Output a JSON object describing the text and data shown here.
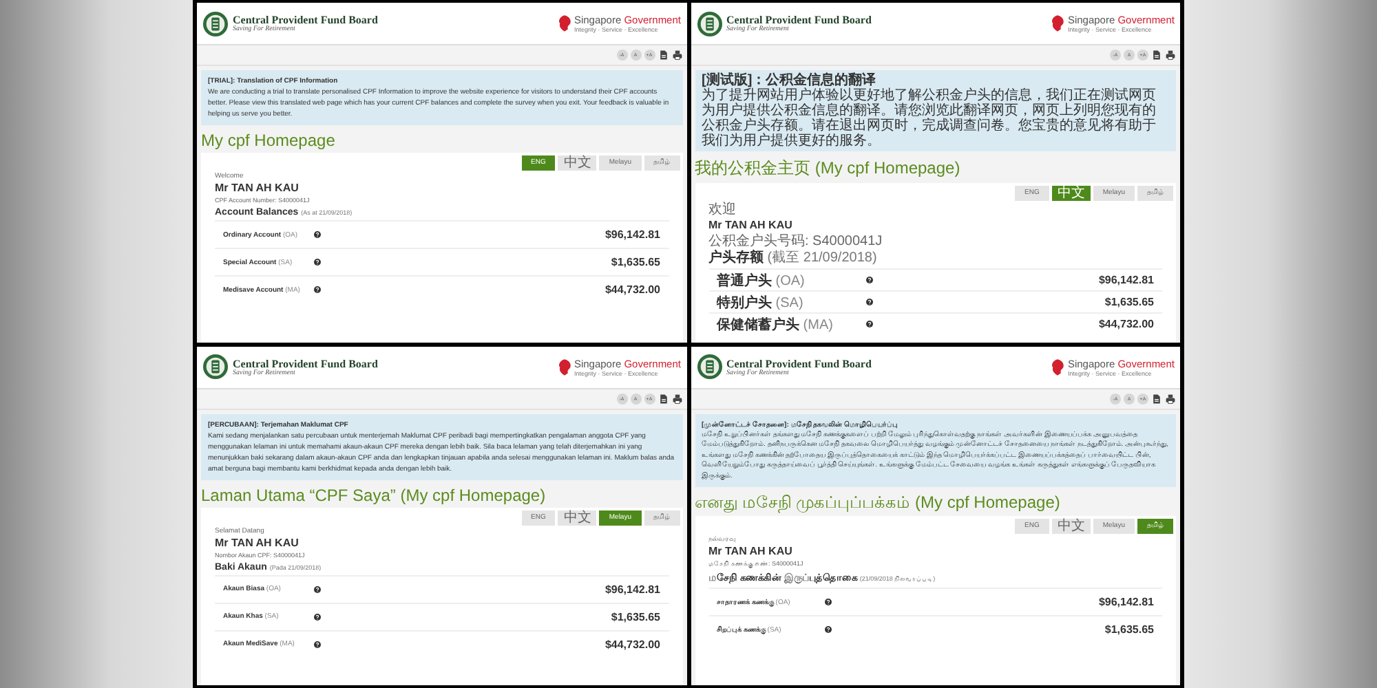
{
  "panels": [
    {
      "header": {
        "org": "Central Provident Fund Board",
        "motto": "Saving For Retirement",
        "gov_name": "Singapore",
        "gov_word": "Government",
        "gov_tagline": "Integrity · Service · Excellence"
      },
      "tools": [
        "-A",
        "A",
        "+A"
      ],
      "notice": {
        "title": "[TRIAL]: Translation of CPF Information",
        "body": "We are conducting a trial to translate personalised CPF Information to improve the website experience for visitors to understand their CPF accounts better. Please view this translated web page which has your current CPF balances and complete the survey when you exit. Your feedback is valuable in helping us serve you better."
      },
      "page_title": "My cpf Homepage",
      "languages": [
        {
          "label": "ENG",
          "selected": true
        },
        {
          "label": "中文",
          "selected": false
        },
        {
          "label": "Melayu",
          "selected": false
        },
        {
          "label": "தமிழ்",
          "selected": false
        }
      ],
      "welcome": "Welcome",
      "name": "Mr TAN AH KAU",
      "account_number": "CPF Account Number: S4000041J",
      "balances": {
        "heading": "Account Balances",
        "date": "(As at 21/09/2018)"
      },
      "accounts": [
        {
          "name": "Ordinary Account",
          "code": "(OA)",
          "amount": "$96,142.81"
        },
        {
          "name": "Special Account",
          "code": "(SA)",
          "amount": "$1,635.65"
        },
        {
          "name": "Medisave Account",
          "code": "(MA)",
          "amount": "$44,732.00"
        }
      ]
    },
    {
      "header": {
        "org": "Central Provident Fund Board",
        "motto": "Saving For Retirement",
        "gov_name": "Singapore",
        "gov_word": "Government",
        "gov_tagline": "Integrity · Service · Excellence"
      },
      "tools": [
        "-A",
        "A",
        "+A"
      ],
      "notice": {
        "title": "[测试版]：公积金信息的翻译",
        "body": "为了提升网站用户体验以更好地了解公积金户头的信息，我们正在测试网页为用户提供公积金信息的翻译。请您浏览此翻译网页，网页上列明您现有的公积金户头存额。请在退出网页时，完成调查问卷。您宝贵的意见将有助于我们为用户提供更好的服务。"
      },
      "page_title": "我的公积金主页 (My cpf Homepage)",
      "languages": [
        {
          "label": "ENG",
          "selected": false
        },
        {
          "label": "中文",
          "selected": true
        },
        {
          "label": "Melayu",
          "selected": false
        },
        {
          "label": "தமிழ்",
          "selected": false
        }
      ],
      "welcome": "欢迎",
      "name": "Mr TAN AH KAU",
      "account_number": "公积金户头号码: S4000041J",
      "balances": {
        "heading": "户头存额",
        "date": "(截至 21/09/2018)"
      },
      "accounts": [
        {
          "name": "普通户头",
          "code": "(OA)",
          "amount": "$96,142.81"
        },
        {
          "name": "特别户头",
          "code": "(SA)",
          "amount": "$1,635.65"
        },
        {
          "name": "保健储蓄户头",
          "code": "(MA)",
          "amount": "$44,732.00"
        }
      ]
    },
    {
      "header": {
        "org": "Central Provident Fund Board",
        "motto": "Saving For Retirement",
        "gov_name": "Singapore",
        "gov_word": "Government",
        "gov_tagline": "Integrity · Service · Excellence"
      },
      "tools": [
        "-A",
        "A",
        "+A"
      ],
      "notice": {
        "title": "[PERCUBAAN]: Terjemahan Maklumat CPF",
        "body": "Kami sedang menjalankan satu percubaan untuk menterjemah Maklumat CPF peribadi bagi mempertingkatkan pengalaman anggota CPF yang menggunakan lelaman ini untuk memahami akaun-akaun CPF mereka dengan lebih baik. Sila baca lelaman yang telah diterjemahkan ini yang menunjukkan baki sekarang dalam akaun-akaun CPF anda dan lengkapkan tinjauan apabila anda selesai menggunakan lelaman ini. Maklum balas anda amat berguna bagi membantu kami berkhidmat kepada anda dengan lebih baik."
      },
      "page_title": "Laman Utama “CPF Saya” (My cpf Homepage)",
      "languages": [
        {
          "label": "ENG",
          "selected": false
        },
        {
          "label": "中文",
          "selected": false
        },
        {
          "label": "Melayu",
          "selected": true
        },
        {
          "label": "தமிழ்",
          "selected": false
        }
      ],
      "welcome": "Selamat Datang",
      "name": "Mr TAN AH KAU",
      "account_number": "Nombor Akaun CPF: S4000041J",
      "balances": {
        "heading": "Baki Akaun",
        "date": "(Pada 21/09/2018)"
      },
      "accounts": [
        {
          "name": "Akaun Biasa",
          "code": "(OA)",
          "amount": "$96,142.81"
        },
        {
          "name": "Akaun Khas",
          "code": "(SA)",
          "amount": "$1,635.65"
        },
        {
          "name": "Akaun MediSave",
          "code": "(MA)",
          "amount": "$44,732.00"
        }
      ]
    },
    {
      "header": {
        "org": "Central Provident Fund Board",
        "motto": "Saving For Retirement",
        "gov_name": "Singapore",
        "gov_word": "Government",
        "gov_tagline": "Integrity · Service · Excellence"
      },
      "tools": [
        "-A",
        "A",
        "+A"
      ],
      "notice": {
        "title": "[முன்னோட்டச் சோதனை]: மசேநி தகவலின் மொழிபெயர்ப்பு",
        "body": "மசேநி உறுப்பினர்கள் தங்களது மசேநி கணக்குகளைப் பற்றி மேலும் புரிந்துகொள்வதற்கு நாங்கள் அவர்களின் இணையப்பக்க அனுபவத்தை மேம்படுத்துகிறோம். தனிநபருக்கென மசேநி தகவலை மொழிபெயர்த்து வழங்கும் முன்னோட்டச் சோதனையை நாங்கள் நடத்துகிறோம். அன்புகூர்ந்து, உங்களது மசேநி கணக்கின் தற்போதைய இருப்புத்தொகையைக் காட்டும் இந்த மொழிபெயர்க்கப்பட்ட இணையப்பக்கத்தைப் பார்வையிட்ட பின், வெளியேறும்போது கருத்தாய்வைப் பூர்த்தி செய்யுங்கள். உங்களுக்கு மேம்பட்ட சேவையை வழங்க உங்கள் கருத்துகள் எங்களுக்குப் பேருதவியாக இருக்கும்."
      },
      "page_title": "எனது மசேநி முகப்புப்பக்கம் (My cpf Homepage)",
      "languages": [
        {
          "label": "ENG",
          "selected": false
        },
        {
          "label": "中文",
          "selected": false
        },
        {
          "label": "Melayu",
          "selected": false
        },
        {
          "label": "தமிழ்",
          "selected": true
        }
      ],
      "welcome": "நல்வரவு",
      "name": "Mr TAN AH KAU",
      "account_number": "மசேநி கணக்கு எண்: S4000041J",
      "balances": {
        "heading": "மசேநி கணக்கின் இருப்புத்தொகை",
        "date": "(21/09/2018 நிலவரப்படி)"
      },
      "accounts": [
        {
          "name": "சாதாரணக் கணக்கு",
          "code": "(OA)",
          "amount": "$96,142.81"
        },
        {
          "name": "சிறப்புக் கணக்கு",
          "code": "(SA)",
          "amount": "$1,635.65"
        }
      ]
    }
  ]
}
